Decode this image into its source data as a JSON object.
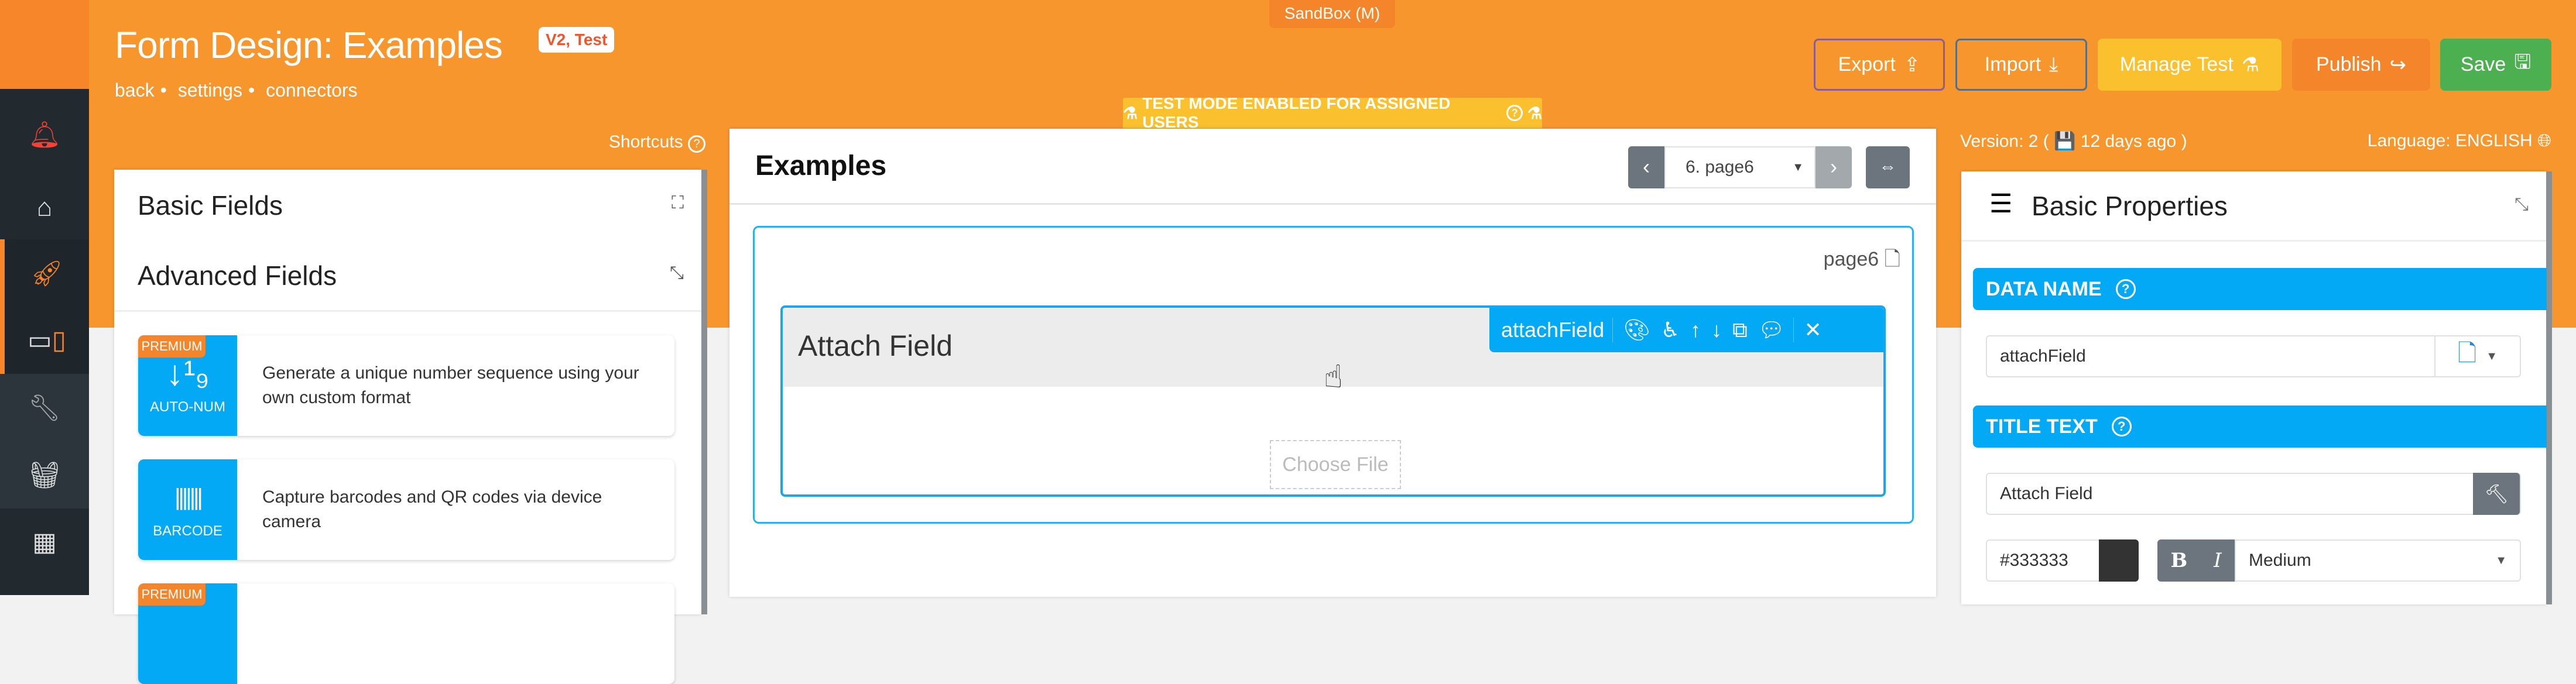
{
  "app": {
    "title": "Form Design: Examples",
    "badge": "V2, Test",
    "environment": "SandBox (M)",
    "links": [
      "back",
      "settings",
      "connectors"
    ],
    "test_banner": "TEST MODE ENABLED FOR ASSIGNED USERS"
  },
  "toolbar": {
    "export": "Export",
    "import": "Import",
    "manage_test": "Manage Test",
    "publish": "Publish",
    "save": "Save"
  },
  "colors": {
    "header": "#f7962c",
    "sidebar": "#222a30",
    "accent": "#03a9f4",
    "save": "#4caf50",
    "manage_test": "#fbc02d",
    "publish": "#f5852b"
  },
  "sidebar": {
    "items": [
      "bell-icon",
      "home-icon",
      "rocket-icon",
      "devices-icon",
      "wrench-icon",
      "basket-icon",
      "dashboard-icon"
    ]
  },
  "left": {
    "shortcuts": "Shortcuts",
    "basic": "Basic Fields",
    "advanced": "Advanced Fields",
    "cards": [
      {
        "premium": "PREMIUM",
        "label": "AUTO-NUM",
        "icon": "↓¹₉",
        "desc": "Generate a unique number sequence using your own custom format"
      },
      {
        "premium": "",
        "label": "BARCODE",
        "icon": "|||||||",
        "desc": "Capture barcodes and QR codes via device camera"
      },
      {
        "premium": "PREMIUM",
        "label": "",
        "icon": "",
        "desc": ""
      }
    ]
  },
  "center": {
    "title": "Examples",
    "page_select": "6. page6",
    "page_label": "page6",
    "field": {
      "title": "Attach Field",
      "data_name": "attachField",
      "choose_file": "Choose File"
    }
  },
  "right": {
    "version": "Version: 2 ( 💾 12 days ago )",
    "language": "Language: ENGLISH",
    "title": "Basic Properties",
    "data_name_label": "DATA NAME",
    "data_name_value": "attachField",
    "title_text_label": "TITLE TEXT",
    "title_text_value": "Attach Field",
    "color_value": "#333333",
    "bold": "B",
    "italic": "I",
    "size": "Medium"
  }
}
